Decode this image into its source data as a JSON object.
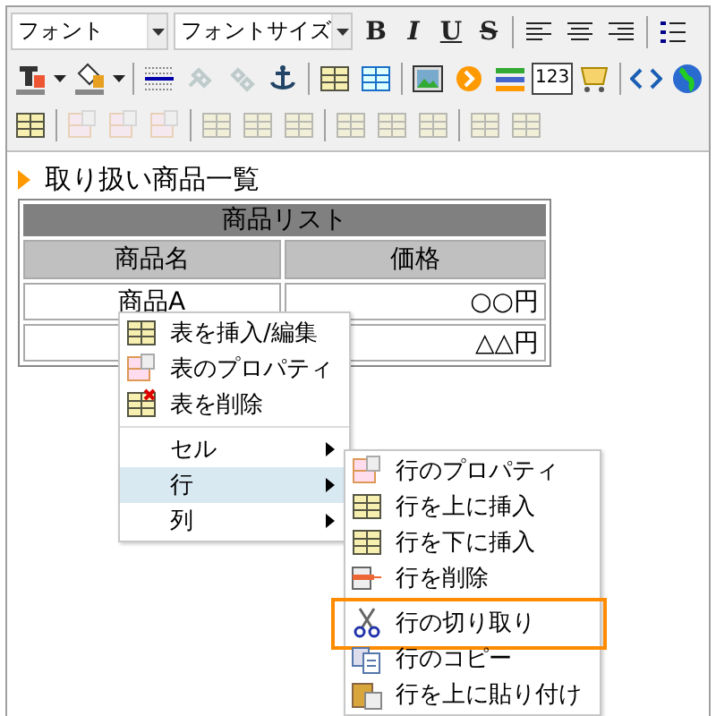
{
  "toolbar": {
    "font_select": {
      "value": "フォント"
    },
    "size_select": {
      "value": "フォントサイズ"
    },
    "rows": [
      [
        {
          "kind": "bold",
          "text": "B",
          "disabled": false
        },
        {
          "kind": "italic",
          "text": "I",
          "disabled": false
        },
        {
          "kind": "underline",
          "text": "U",
          "disabled": false
        },
        {
          "kind": "strike",
          "text": "S",
          "disabled": false
        },
        {
          "kind": "sep"
        },
        {
          "kind": "align-left",
          "disabled": false
        },
        {
          "kind": "align-center",
          "disabled": false
        },
        {
          "kind": "align-right",
          "disabled": false
        },
        {
          "kind": "sep"
        },
        {
          "kind": "list",
          "disabled": false
        }
      ],
      [
        {
          "kind": "text-color",
          "disabled": false
        },
        {
          "kind": "caret",
          "disabled": false
        },
        {
          "kind": "fill-color",
          "disabled": false
        },
        {
          "kind": "caret",
          "disabled": false
        },
        {
          "kind": "sep"
        },
        {
          "kind": "rule",
          "disabled": false
        },
        {
          "kind": "link",
          "disabled": true
        },
        {
          "kind": "unlink",
          "disabled": true
        },
        {
          "kind": "anchor",
          "disabled": false
        },
        {
          "kind": "sep"
        },
        {
          "kind": "table",
          "disabled": false
        },
        {
          "kind": "table-blue",
          "disabled": false
        },
        {
          "kind": "sep"
        },
        {
          "kind": "image",
          "disabled": false
        },
        {
          "kind": "circle-arrow",
          "disabled": false
        },
        {
          "kind": "bars",
          "disabled": false
        },
        {
          "kind": "number",
          "text": "123",
          "disabled": false
        },
        {
          "kind": "cart",
          "disabled": false
        },
        {
          "kind": "sep"
        },
        {
          "kind": "code",
          "disabled": false
        },
        {
          "kind": "globe",
          "disabled": false
        }
      ],
      [
        {
          "kind": "table",
          "disabled": false
        },
        {
          "kind": "sep"
        },
        {
          "kind": "table-props",
          "disabled": true
        },
        {
          "kind": "table-props",
          "disabled": true
        },
        {
          "kind": "table-props",
          "disabled": true
        },
        {
          "kind": "sep"
        },
        {
          "kind": "table",
          "disabled": true
        },
        {
          "kind": "table",
          "disabled": true
        },
        {
          "kind": "table",
          "disabled": true
        },
        {
          "kind": "sep"
        },
        {
          "kind": "table",
          "disabled": true
        },
        {
          "kind": "table",
          "disabled": true
        },
        {
          "kind": "table",
          "disabled": true
        },
        {
          "kind": "sep"
        },
        {
          "kind": "table",
          "disabled": true
        },
        {
          "kind": "table",
          "disabled": true
        }
      ]
    ]
  },
  "heading": "取り扱い商品一覧",
  "table": {
    "caption": "商品リスト",
    "columns": [
      "商品名",
      "価格"
    ],
    "rows": [
      [
        "商品A",
        "○○円"
      ],
      [
        "",
        "△△円"
      ]
    ]
  },
  "context_menu": {
    "items": [
      {
        "kind": "command",
        "label": "表を挿入/編集",
        "selected": false
      },
      {
        "kind": "command",
        "label": "表のプロパティ",
        "selected": false
      },
      {
        "kind": "command",
        "label": "表を削除",
        "selected": false
      },
      {
        "kind": "separator"
      },
      {
        "kind": "submenu",
        "label": "セル",
        "selected": false
      },
      {
        "kind": "submenu",
        "label": "行",
        "selected": true
      },
      {
        "kind": "submenu",
        "label": "列",
        "selected": false
      }
    ]
  },
  "row_submenu": {
    "items": [
      {
        "kind": "command",
        "label": "行のプロパティ",
        "annotated": false
      },
      {
        "kind": "command",
        "label": "行を上に挿入",
        "annotated": false
      },
      {
        "kind": "command",
        "label": "行を下に挿入",
        "annotated": false
      },
      {
        "kind": "command",
        "label": "行を削除",
        "annotated": false
      },
      {
        "kind": "separator"
      },
      {
        "kind": "command",
        "label": "行の切り取り",
        "annotated": true
      },
      {
        "kind": "command",
        "label": "行のコピー",
        "annotated": false
      },
      {
        "kind": "command",
        "label": "行を上に貼り付け",
        "annotated": false
      }
    ]
  }
}
